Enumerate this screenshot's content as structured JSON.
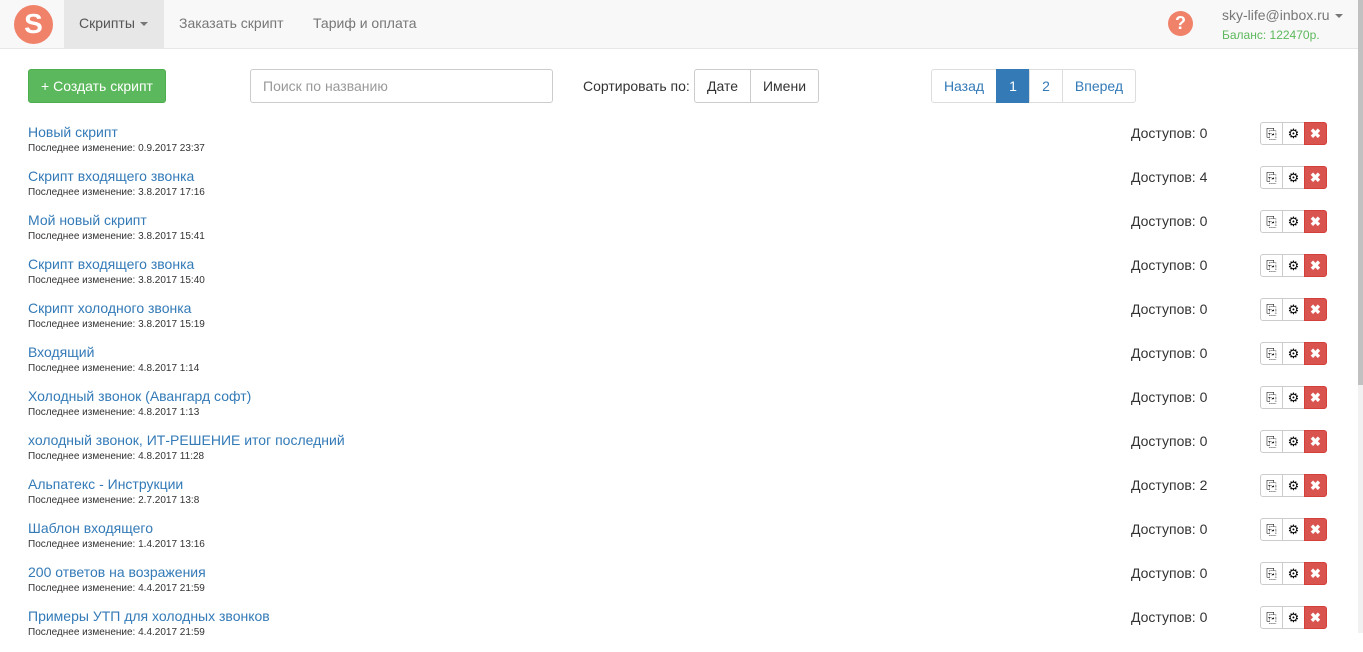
{
  "nav": {
    "logo": "S",
    "scripts": "Скрипты",
    "order": "Заказать скрипт",
    "tariff": "Тариф и оплата",
    "help": "?",
    "user": "sky-life@inbox.ru",
    "balance": "Баланс: 122470р."
  },
  "toolbar": {
    "create": "+ Создать скрипт",
    "search_placeholder": "Поиск по названию",
    "sort_label": "Сортировать по:",
    "sort_date": "Дате",
    "sort_name": "Имени"
  },
  "pagination": {
    "prev": "Назад",
    "pages": [
      "1",
      "2"
    ],
    "next": "Вперед",
    "current": "1"
  },
  "scripts": [
    {
      "title": "Новый скрипт",
      "modified": "Последнее изменение: 0.9.2017 23:37",
      "access": "Доступов: 0"
    },
    {
      "title": "Скрипт входящего звонка",
      "modified": "Последнее изменение: 3.8.2017 17:16",
      "access": "Доступов: 4"
    },
    {
      "title": "Мой новый скрипт",
      "modified": "Последнее изменение: 3.8.2017 15:41",
      "access": "Доступов: 0"
    },
    {
      "title": "Скрипт входящего звонка",
      "modified": "Последнее изменение: 3.8.2017 15:40",
      "access": "Доступов: 0"
    },
    {
      "title": "Скрипт холодного звонка",
      "modified": "Последнее изменение: 3.8.2017 15:19",
      "access": "Доступов: 0"
    },
    {
      "title": "Входящий",
      "modified": "Последнее изменение: 4.8.2017 1:14",
      "access": "Доступов: 0"
    },
    {
      "title": "Холодный звонок (Авангард софт)",
      "modified": "Последнее изменение: 4.8.2017 1:13",
      "access": "Доступов: 0"
    },
    {
      "title": "холодный звонок, ИТ-РЕШЕНИЕ итог последний",
      "modified": "Последнее изменение: 4.8.2017 11:28",
      "access": "Доступов: 0"
    },
    {
      "title": "Альпатекс - Инструкции",
      "modified": "Последнее изменение: 2.7.2017 13:8",
      "access": "Доступов: 2"
    },
    {
      "title": "Шаблон входящего",
      "modified": "Последнее изменение: 1.4.2017 13:16",
      "access": "Доступов: 0"
    },
    {
      "title": "200 ответов на возражения",
      "modified": "Последнее изменение: 4.4.2017 21:59",
      "access": "Доступов: 0"
    },
    {
      "title": "Примеры УТП для холодных звонков",
      "modified": "Последнее изменение: 4.4.2017 21:59",
      "access": "Доступов: 0"
    }
  ],
  "icons": {
    "copy": "copy-icon",
    "settings": "gear-icon",
    "delete": "close-icon"
  }
}
